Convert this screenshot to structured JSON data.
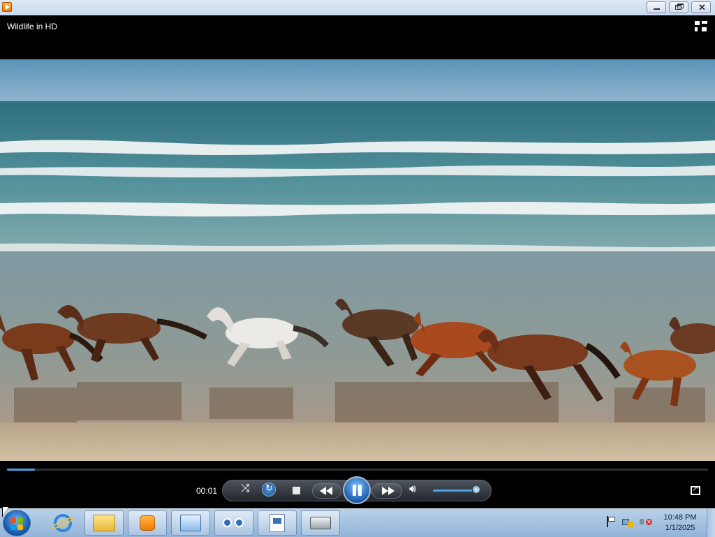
{
  "window": {
    "app_icon": "media-player-icon",
    "controls": [
      "minimize-icon",
      "restore-icon",
      "close-icon"
    ]
  },
  "player": {
    "title": "Wildlife in HD",
    "switch_icon": "switch-to-library-icon"
  },
  "playback": {
    "elapsed": "00:01",
    "progress": 0.04,
    "volume": 0.9,
    "state": "playing",
    "buttons": [
      "shuffle-icon",
      "repeat-icon",
      "stop-icon",
      "previous-icon",
      "pause-icon",
      "next-icon",
      "volume-icon",
      "fullscreen-icon"
    ],
    "accent_color": "#4aa3e8"
  },
  "taskbar": {
    "pinned": [
      "internet-explorer-icon",
      "folder-icon",
      "media-player-icon",
      "control-panel-icon",
      "people-icon",
      "wordpad-icon",
      "printer-icon"
    ],
    "tray_icons": [
      "flag-icon",
      "network-icon",
      "volume-muted-icon"
    ],
    "clock_time": "10:48 PM",
    "clock_date": "1/1/2025"
  }
}
